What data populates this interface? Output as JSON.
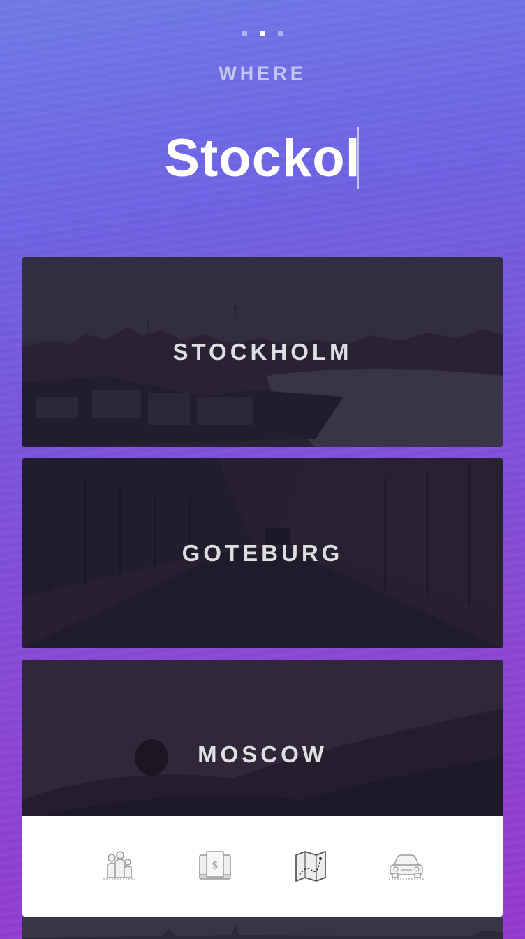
{
  "pager": {
    "count": 3,
    "active_index": 1
  },
  "header": {
    "section_label": "WHERE"
  },
  "search": {
    "value": "Stockol"
  },
  "results": [
    {
      "label": "STOCKHOLM"
    },
    {
      "label": "GOTEBURG"
    },
    {
      "label": "MOSCOW"
    }
  ],
  "bottom_nav": [
    {
      "icon": "family-icon"
    },
    {
      "icon": "money-icon"
    },
    {
      "icon": "map-icon"
    },
    {
      "icon": "car-icon"
    }
  ],
  "colors": {
    "gradient_top": "#6f7ae8",
    "gradient_bottom": "#9437d0",
    "card_overlay": "#2b2338",
    "nav_background": "#ffffff"
  }
}
